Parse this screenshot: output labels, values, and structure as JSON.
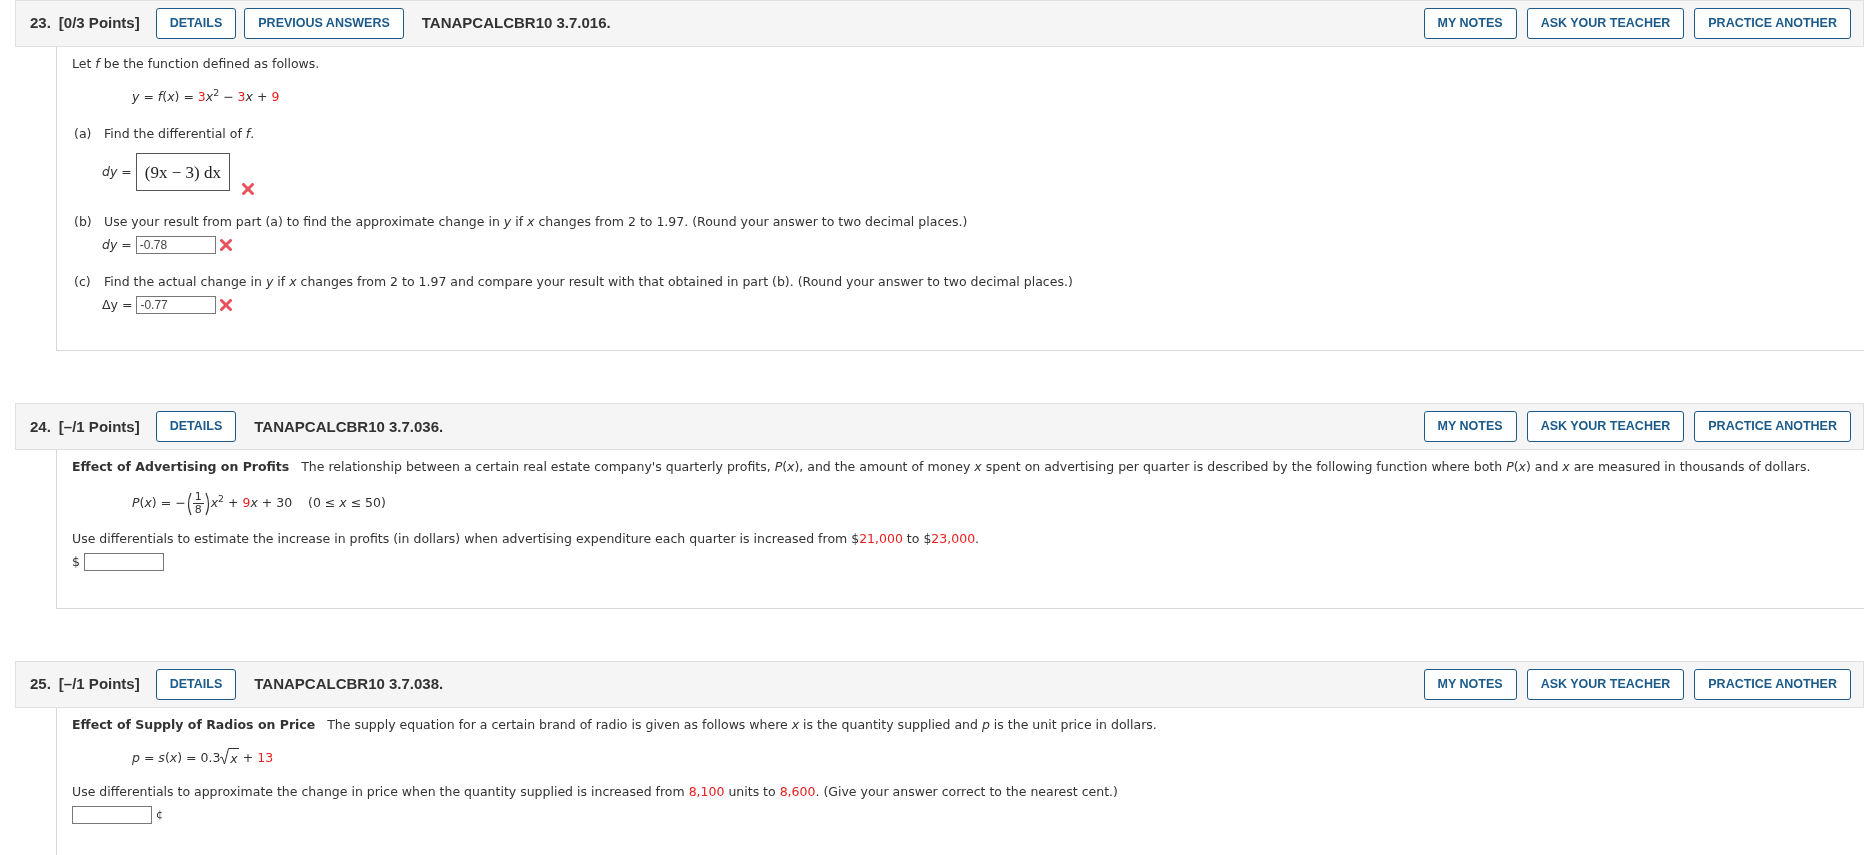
{
  "questions": [
    {
      "number": "23.",
      "points": "[0/3 Points]",
      "buttons_left": [
        "DETAILS",
        "PREVIOUS ANSWERS"
      ],
      "code": "TANAPCALCBR10 3.7.016.",
      "buttons_right": [
        "MY NOTES",
        "ASK YOUR TEACHER",
        "PRACTICE ANOTHER"
      ],
      "body": [
        {
          "kind": "paragraph",
          "text": "Let *f* be the function defined as follows."
        },
        {
          "kind": "formula",
          "segments": [
            {
              "kind": "text",
              "text": "*y* = *f*(*x*) = "
            },
            {
              "kind": "text",
              "text": "3",
              "given": true
            },
            {
              "kind": "text",
              "text": "*x*$^{2}$ − "
            },
            {
              "kind": "text",
              "text": "3",
              "given": true
            },
            {
              "kind": "text",
              "text": "*x* + "
            },
            {
              "kind": "text",
              "text": "9",
              "given": true
            }
          ]
        },
        {
          "kind": "part",
          "label": "(a)",
          "text": "Find the differential of *f*."
        },
        {
          "kind": "math_answer",
          "prefix": "*dy* =",
          "value": "(9x − 3) dx",
          "correct": false
        },
        {
          "kind": "part",
          "label": "(b)",
          "text": "Use your result from part (a) to find the approximate change in *y* if *x* changes from 2 to 1.97. (Round your answer to two decimal places.)"
        },
        {
          "kind": "answer",
          "prefix": "*dy* =",
          "value": "-0.78",
          "correct": false
        },
        {
          "kind": "part",
          "label": "(c)",
          "text": "Find the actual change in *y* if *x* changes from 2 to 1.97 and compare your result with that obtained in part (b). (Round your answer to two decimal places.)"
        },
        {
          "kind": "answer",
          "prefix": "Δy =",
          "value": "-0.77",
          "correct": false
        }
      ]
    },
    {
      "number": "24.",
      "points": "[–/1 Points]",
      "buttons_left": [
        "DETAILS"
      ],
      "code": "TANAPCALCBR10 3.7.036.",
      "buttons_right": [
        "MY NOTES",
        "ASK YOUR TEACHER",
        "PRACTICE ANOTHER"
      ],
      "body": [
        {
          "kind": "paragraph",
          "text": "**Effect of Advertising on Profits**   The relationship between a certain real estate company's quarterly profits, *P*(*x*), and the amount of money *x* spent on advertising per quarter is described by the following function where both *P*(*x*) and *x* are measured in thousands of dollars."
        },
        {
          "kind": "formula",
          "segments": [
            {
              "kind": "text",
              "text": "*P*(*x*) = −"
            },
            {
              "kind": "fraction",
              "numerator": "1",
              "denominator": "8"
            },
            {
              "kind": "text",
              "text": "*x*$^{2}$ + "
            },
            {
              "kind": "text",
              "text": "9",
              "given": true
            },
            {
              "kind": "text",
              "text": "*x* + 30    (0 ≤ *x* ≤ 50)"
            }
          ]
        },
        {
          "kind": "rich_line",
          "segments": [
            {
              "kind": "text",
              "text": "Use differentials to estimate the increase in profits (in dollars) when advertising expenditure each quarter is increased from $"
            },
            {
              "kind": "text",
              "text": "21,000",
              "given": true
            },
            {
              "kind": "text",
              "text": " to $"
            },
            {
              "kind": "text",
              "text": "23,000",
              "given": true
            },
            {
              "kind": "text",
              "text": "."
            }
          ]
        },
        {
          "kind": "answer",
          "prefix": "$"
        }
      ]
    },
    {
      "number": "25.",
      "points": "[–/1 Points]",
      "buttons_left": [
        "DETAILS"
      ],
      "code": "TANAPCALCBR10 3.7.038.",
      "buttons_right": [
        "MY NOTES",
        "ASK YOUR TEACHER",
        "PRACTICE ANOTHER"
      ],
      "body": [
        {
          "kind": "paragraph",
          "text": "**Effect of Supply of Radios on Price**   The supply equation for a certain brand of radio is given as follows where *x* is the quantity supplied and *p* is the unit price in dollars."
        },
        {
          "kind": "formula",
          "segments": [
            {
              "kind": "text",
              "text": "*p* = *s*(*x*) = 0.3"
            },
            {
              "kind": "sqrt",
              "text": "*x*"
            },
            {
              "kind": "text",
              "text": " + "
            },
            {
              "kind": "text",
              "text": "13",
              "given": true
            }
          ]
        },
        {
          "kind": "rich_line",
          "segments": [
            {
              "kind": "text",
              "text": "Use differentials to approximate the change in price when the quantity supplied is increased from "
            },
            {
              "kind": "text",
              "text": "8,100",
              "given": true
            },
            {
              "kind": "text",
              "text": " units to "
            },
            {
              "kind": "text",
              "text": "8,600",
              "given": true
            },
            {
              "kind": "text",
              "text": ". (Give your answer correct to the nearest cent.)"
            }
          ]
        },
        {
          "kind": "answer",
          "suffix": "¢"
        }
      ]
    }
  ]
}
